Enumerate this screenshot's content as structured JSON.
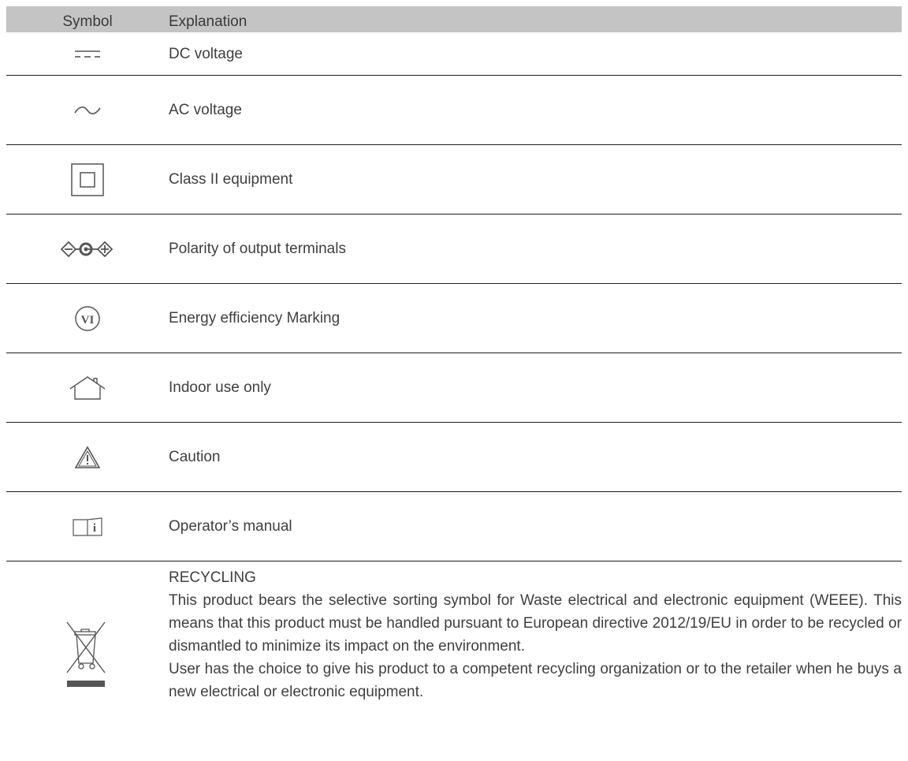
{
  "header": {
    "symbol": "Symbol",
    "explanation": "Explanation"
  },
  "rows": [
    {
      "icon": "dc-voltage-icon",
      "text": "DC voltage"
    },
    {
      "icon": "ac-voltage-icon",
      "text": "AC voltage"
    },
    {
      "icon": "class-ii-icon",
      "text": "Class II equipment"
    },
    {
      "icon": "polarity-icon",
      "text": "Polarity of output terminals"
    },
    {
      "icon": "energy-efficiency-icon",
      "text": "Energy efficiency Marking",
      "icon_label": "VI"
    },
    {
      "icon": "indoor-use-icon",
      "text": "Indoor use only"
    },
    {
      "icon": "caution-icon",
      "text": "Caution"
    },
    {
      "icon": "manual-icon",
      "text": "Operator’s manual"
    }
  ],
  "recycling": {
    "icon": "weee-bin-icon",
    "title": "RECYCLING",
    "paragraph1": "This product bears the selective sorting symbol for Waste electrical and electronic equipment (WEEE). This means that this product must be handled pursuant to European directive 2012/19/EU in order to be recycled or dismantled to minimize its impact on the environment.",
    "paragraph2": "User has the choice to give his product to a competent recycling organization or to the retailer when he buys a new electrical or electronic equipment."
  },
  "colors": {
    "header_bg": "#c4c4c4",
    "text": "#3f3f3f",
    "rule": "#1c1c1c",
    "icon": "#555555"
  }
}
